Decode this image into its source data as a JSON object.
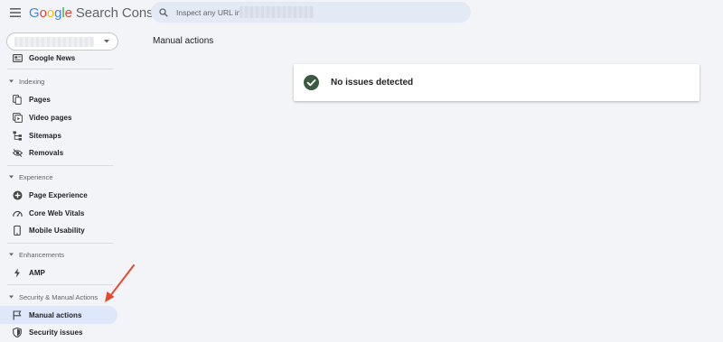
{
  "header": {
    "brand_google": [
      "G",
      "o",
      "o",
      "g",
      "l",
      "e"
    ],
    "brand_product": "Search Console",
    "search_placeholder": "Inspect any URL in"
  },
  "sidebar": {
    "items_top": [
      {
        "label": "Google News",
        "icon": "news-icon"
      }
    ],
    "sections": [
      {
        "title": "Indexing",
        "items": [
          {
            "label": "Pages",
            "icon": "pages-icon"
          },
          {
            "label": "Video pages",
            "icon": "video-pages-icon"
          },
          {
            "label": "Sitemaps",
            "icon": "sitemap-icon"
          },
          {
            "label": "Removals",
            "icon": "removals-icon"
          }
        ]
      },
      {
        "title": "Experience",
        "items": [
          {
            "label": "Page Experience",
            "icon": "page-experience-icon"
          },
          {
            "label": "Core Web Vitals",
            "icon": "speedometer-icon"
          },
          {
            "label": "Mobile Usability",
            "icon": "mobile-icon"
          }
        ]
      },
      {
        "title": "Enhancements",
        "items": [
          {
            "label": "AMP",
            "icon": "bolt-icon"
          }
        ]
      },
      {
        "title": "Security & Manual Actions",
        "items": [
          {
            "label": "Manual actions",
            "icon": "flag-icon",
            "active": true
          },
          {
            "label": "Security issues",
            "icon": "shield-icon"
          }
        ]
      }
    ]
  },
  "main": {
    "title": "Manual actions",
    "status_message": "No issues detected"
  },
  "colors": {
    "background": "#f3f4f8",
    "active_item": "#dfe7fb",
    "check": "#3c5a3f",
    "annotation_arrow": "#e8482b"
  }
}
